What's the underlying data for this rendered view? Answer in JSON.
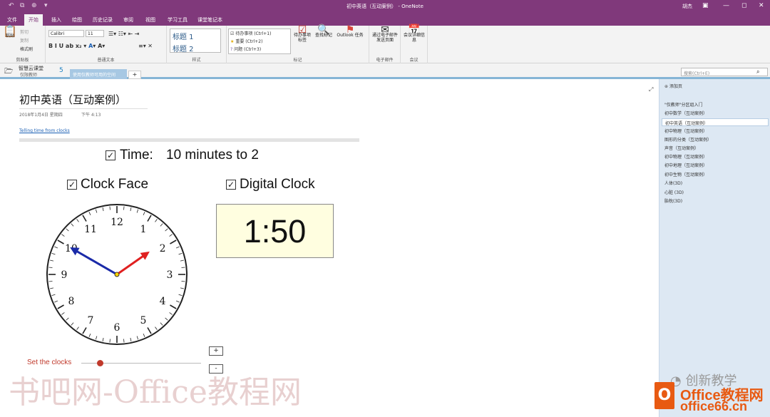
{
  "window": {
    "title": "初中英语（互动案例） - OneNote",
    "user": "胡杰"
  },
  "menu_tabs": [
    "文件",
    "开始",
    "插入",
    "绘图",
    "历史记录",
    "审阅",
    "视图",
    "学习工具",
    "课堂笔记本"
  ],
  "ribbon": {
    "paste": "粘贴",
    "cut": "剪切",
    "copy": "复制",
    "format_painter": "格式刷",
    "clipboard": "剪贴板",
    "font_name": "Calibri",
    "font_size": "11",
    "basic_text": "普通文本",
    "styles": [
      "标题 1",
      "标题 2"
    ],
    "styles_label": "样式",
    "tags": [
      "待办事项 (Ctrl+1)",
      "重要 (Ctrl+2)",
      "问题 (Ctrl+3)"
    ],
    "todo_tag": "待办事项标签",
    "find_tags": "查找标记",
    "outlook_tasks": "Outlook 任务",
    "tags_label": "标记",
    "email_page": "通过电子邮件发送页面",
    "email_label": "电子邮件",
    "meeting": "会议详细信息",
    "meeting_label": "会议"
  },
  "notebook": {
    "name": "智慧云课堂",
    "sub": "仅限教师",
    "number": "5",
    "section": "使用仅教师可用的空间",
    "add": "+"
  },
  "search": {
    "placeholder": "搜索(Ctrl+E)"
  },
  "page": {
    "title": "初中英语（互动案例）",
    "date": "2018年1月4日 星期四",
    "time": "下午 4:13",
    "link": "Telling time from clocks"
  },
  "time_row": {
    "label": "Time:",
    "value": "10 minutes to 2"
  },
  "clock_face_label": "Clock Face",
  "digital_clock_label": "Digital Clock",
  "digital_time": "1:50",
  "clock": {
    "numbers": [
      "12",
      "1",
      "2",
      "3",
      "4",
      "5",
      "6",
      "7",
      "8",
      "9",
      "10",
      "11"
    ],
    "hour_hand": 1.833,
    "minute_hand": 50
  },
  "set_clocks": "Set the clocks",
  "buttons": {
    "plus": "+",
    "minus": "-"
  },
  "sidebar": {
    "add_page": "添加页",
    "pages": [
      "\"仅教师\"分区组入门",
      "初中数学（互动案例）",
      "初中英语（互动案例）",
      "初中物理（互动案例）",
      "图形的分类（互动案例）",
      "声音（互动案例）",
      "初中物理（互动案例）",
      "初中地理（互动案例）",
      "初中生物（互动案例）",
      "人体(3D)",
      "心脏 (3D)",
      "胎枕(3D)"
    ],
    "selected_index": 2
  },
  "watermark": {
    "text": "书吧网-Office教程网",
    "brand1": "Office教程网",
    "brand2": "office66.cn",
    "wechat": "创新教学"
  }
}
